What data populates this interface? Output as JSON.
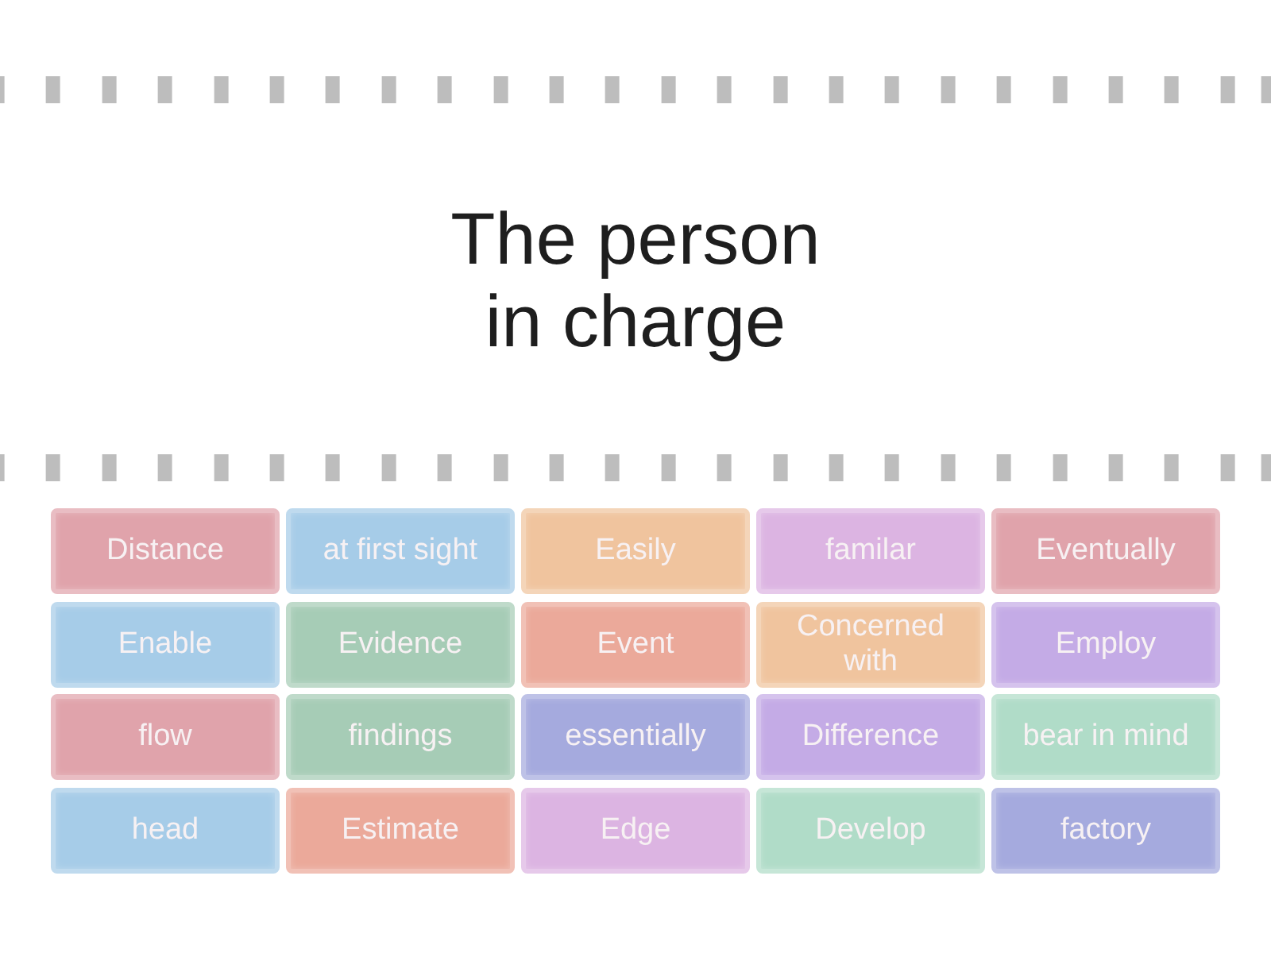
{
  "title": "The person in charge",
  "tiles": [
    {
      "text": "Distance",
      "color": "#e0a3ab"
    },
    {
      "text": "at first sight",
      "color": "#a6cce8"
    },
    {
      "text": "Easily",
      "color": "#f0c49e"
    },
    {
      "text": "familar",
      "color": "#dcb4e2"
    },
    {
      "text": "Eventually",
      "color": "#e0a3ab"
    },
    {
      "text": "Enable",
      "color": "#a6cce8"
    },
    {
      "text": "Evidence",
      "color": "#a6ccb6"
    },
    {
      "text": "Event",
      "color": "#eba99a"
    },
    {
      "text": "Concerned with",
      "color": "#f0c49e"
    },
    {
      "text": "Employ",
      "color": "#c4abe6"
    },
    {
      "text": "flow",
      "color": "#e0a3ab"
    },
    {
      "text": "findings",
      "color": "#a6ccb6"
    },
    {
      "text": "essentially",
      "color": "#a5aade"
    },
    {
      "text": "Difference",
      "color": "#c4abe6"
    },
    {
      "text": "bear in mind",
      "color": "#b0dcc8"
    },
    {
      "text": "head",
      "color": "#a6cce8"
    },
    {
      "text": "Estimate",
      "color": "#eba99a"
    },
    {
      "text": "Edge",
      "color": "#dcb4e2"
    },
    {
      "text": "Develop",
      "color": "#b0dcc8"
    },
    {
      "text": "factory",
      "color": "#a5aade"
    }
  ]
}
